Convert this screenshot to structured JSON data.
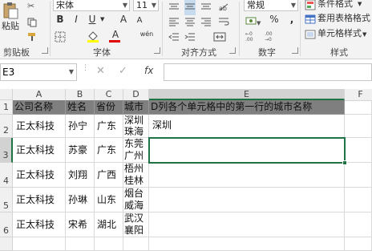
{
  "ribbon": {
    "clipboard": {
      "paste_label": "粘贴",
      "group_label": "剪贴板"
    },
    "font": {
      "font_name": "宋体",
      "font_size": "11",
      "bold": "B",
      "italic": "I",
      "underline": "U",
      "grow": "A",
      "shrink": "A",
      "font_color_glyph": "A",
      "phonetic": "wén",
      "group_label": "字体"
    },
    "alignment": {
      "group_label": "对齐方式"
    },
    "number": {
      "format": "常规",
      "percent": "%",
      "comma": ",",
      "group_label": "数字"
    },
    "styles": {
      "conditional": "条件格式",
      "table": "套用表格格式",
      "cell_styles": "单元格样式",
      "group_label": "样式"
    }
  },
  "formula_bar": {
    "name_box": "E3",
    "fx": "fx",
    "formula": ""
  },
  "grid": {
    "columns": [
      "A",
      "B",
      "C",
      "D",
      "E",
      "F"
    ],
    "rows": [
      "1",
      "2",
      "3",
      "4",
      "5",
      "6"
    ],
    "header_row": [
      "公司名称",
      "姓名",
      "省份",
      "城市",
      "D列各个单元格中的第一行的城市名称"
    ],
    "data_rows": [
      {
        "a": "正太科技",
        "b": "孙宁",
        "c": "广东",
        "d1": "深圳",
        "d2": "珠海",
        "e": "深圳"
      },
      {
        "a": "正太科技",
        "b": "苏豪",
        "c": "广东",
        "d1": "东莞",
        "d2": "广州",
        "e": ""
      },
      {
        "a": "正太科技",
        "b": "刘翔",
        "c": "广西",
        "d1": "梧州",
        "d2": "桂林",
        "e": ""
      },
      {
        "a": "正太科技",
        "b": "孙琳",
        "c": "山东",
        "d1": "烟台",
        "d2": "威海",
        "e": ""
      },
      {
        "a": "正太科技",
        "b": "宋希",
        "c": "湖北",
        "d1": "武汉",
        "d2": "襄阳",
        "e": ""
      }
    ],
    "selected_cell": "E3"
  },
  "colors": {
    "header_fill": "#7f7f7f",
    "selection_border": "#217346",
    "ribbon_bg": "#f3f3f3"
  }
}
